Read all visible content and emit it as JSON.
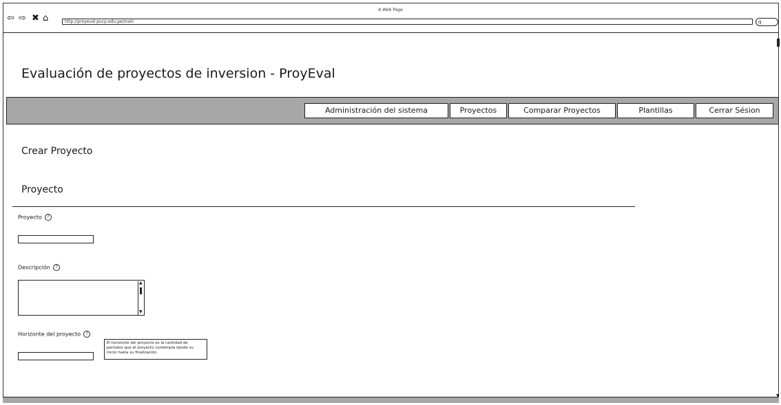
{
  "browser": {
    "title": "A Web Page",
    "url": "http://proyeval.pucp.edu.pe/main",
    "search_glyph": "q",
    "icons": [
      "back-arrow-icon",
      "forward-arrow-icon",
      "close-icon",
      "home-icon"
    ]
  },
  "page": {
    "title": "Evaluación de proyectos de inversion - ProyEval"
  },
  "menu": {
    "items": [
      {
        "label": "Administración del sistema"
      },
      {
        "label": "Proyectos"
      },
      {
        "label": "Comparar Proyectos"
      },
      {
        "label": "Plantillas"
      },
      {
        "label": "Cerrar Sésion"
      }
    ]
  },
  "main": {
    "heading": "Crear Proyecto",
    "section": "Proyecto",
    "fields": [
      {
        "label": "Proyecto",
        "value": ""
      },
      {
        "label": "Descripción",
        "value": ""
      },
      {
        "label": "Horizonte del proyecto",
        "value": ""
      }
    ],
    "tooltip": "El horizonte del proyecto es la cantidad de periodos que el proyecto contempla desde su inicio hasta su finalización."
  },
  "colors": {
    "menu_bar": "#a7a7a7",
    "border": "#222222",
    "background": "#ffffff"
  }
}
